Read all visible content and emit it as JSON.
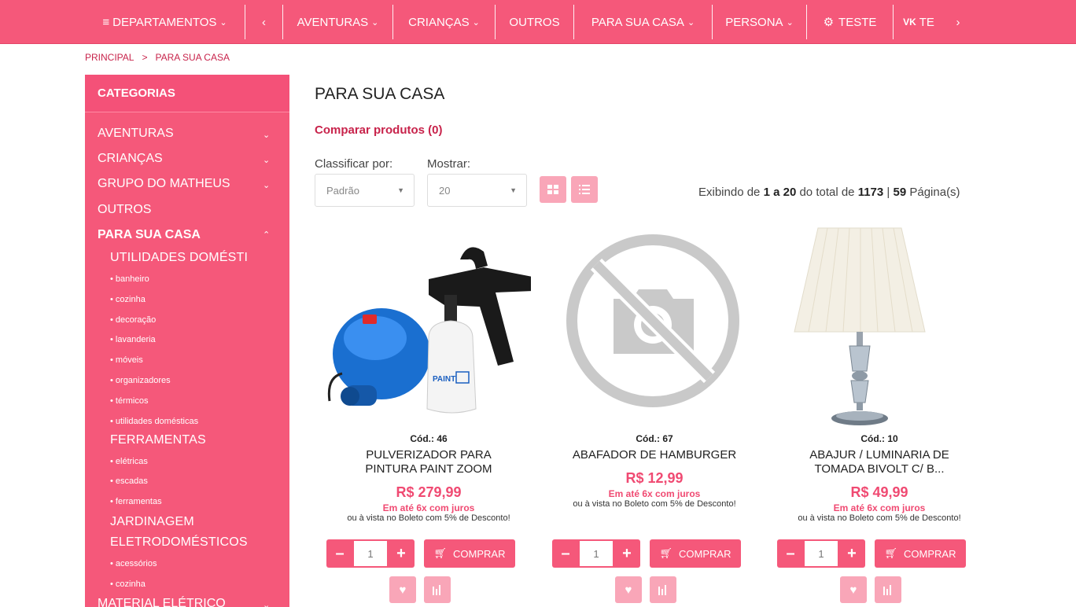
{
  "nav": {
    "departments": "DEPARTAMENTOS",
    "prev_icon": "chevron-left-icon",
    "items": [
      {
        "label": "AVENTURAS"
      },
      {
        "label": "CRIANÇAS"
      },
      {
        "label": "OUTROS"
      },
      {
        "label": "PARA SUA CASA"
      },
      {
        "label": "PERSONA"
      },
      {
        "label": "TESTE"
      },
      {
        "label": "TE"
      }
    ],
    "next_icon": "chevron-right-icon"
  },
  "breadcrumb": {
    "home": "PRINCIPAL",
    "separator": ">",
    "current": "PARA SUA CASA"
  },
  "sidebar": {
    "title": "CATEGORIAS",
    "categories": [
      {
        "label": "AVENTURAS",
        "expanded": false
      },
      {
        "label": "CRIANÇAS",
        "expanded": false
      },
      {
        "label": "GRUPO DO MATHEUS",
        "expanded": false
      },
      {
        "label": "OUTROS"
      },
      {
        "label": "PARA SUA CASA",
        "expanded": true
      }
    ],
    "subcategories": [
      {
        "label": "UTILIDADES DOMÉSTI",
        "children": [
          "• banheiro",
          "• cozinha",
          "• decoração",
          "• lavanderia",
          "• móveis",
          "• organizadores",
          "• térmicos",
          "• utilidades domésticas"
        ]
      },
      {
        "label": "FERRAMENTAS",
        "children": [
          "• elétricas",
          "• escadas",
          "• ferramentas"
        ]
      },
      {
        "label": "JARDINAGEM",
        "children": []
      },
      {
        "label": "ELETRODOMÉSTICOS",
        "children": [
          "• acessórios",
          "• cozinha"
        ]
      }
    ],
    "cut_off_category": "MATERIAL ELÉTRICO"
  },
  "main": {
    "title": "PARA SUA CASA",
    "compare": "Comparar produtos (0)",
    "sort_label": "Classificar por:",
    "sort_value": "Padrão",
    "show_label": "Mostrar:",
    "show_value": "20",
    "pager": {
      "prefix": "Exibindo de",
      "range": "1 a 20",
      "middle": "do total de",
      "total": "1173",
      "sep": "|",
      "pages": "59",
      "suffix": "Página(s)"
    }
  },
  "products": [
    {
      "code": "Cód.: 46",
      "name": "PULVERIZADOR PARA PINTURA PAINT ZOOM",
      "price": "R$ 279,99",
      "installments": "Em até 6x com juros",
      "boleto": "ou à vista no Boleto com 5% de Desconto!",
      "qty": "1",
      "buy": "COMPRAR",
      "image": "paint-sprayer-image",
      "brand_text": "PAINT ZOOM"
    },
    {
      "code": "Cód.: 67",
      "name": "ABAFADOR DE HAMBURGER",
      "price": "R$ 12,99",
      "installments": "Em até 6x com juros",
      "boleto": "ou à vista no Boleto com 5% de Desconto!",
      "qty": "1",
      "buy": "COMPRAR",
      "image": "no-photo-icon"
    },
    {
      "code": "Cód.: 10",
      "name": "ABAJUR / LUMINARIA DE TOMADA BIVOLT C/ B...",
      "price": "R$ 49,99",
      "installments": "Em até 6x com juros",
      "boleto": "ou à vista no Boleto com 5% de Desconto!",
      "qty": "1",
      "buy": "COMPRAR",
      "image": "table-lamp-image"
    }
  ],
  "colors": {
    "primary": "#f5587a",
    "light": "#f9a6b8",
    "accent_text": "#c8234b",
    "price": "#f04a72"
  }
}
